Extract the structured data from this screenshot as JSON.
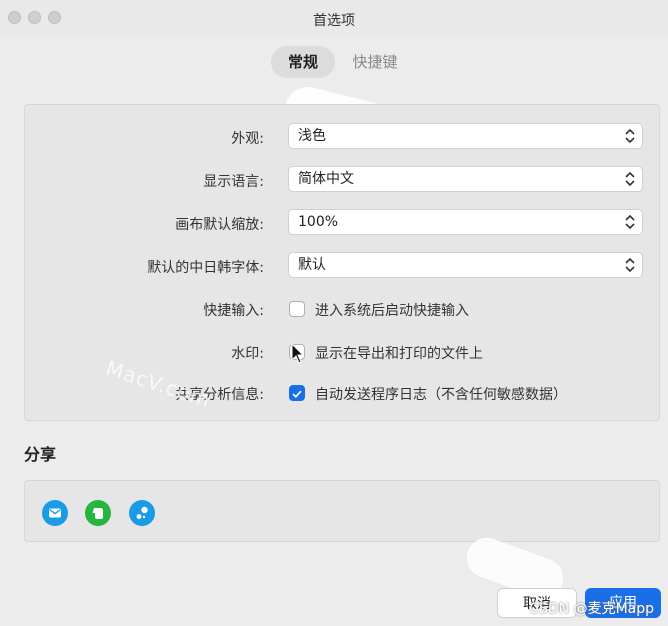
{
  "window": {
    "title": "首选项"
  },
  "tabs": [
    {
      "label": "常规",
      "active": true
    },
    {
      "label": "快捷键",
      "active": false
    }
  ],
  "general": {
    "appearance": {
      "label": "外观:",
      "value": "浅色"
    },
    "language": {
      "label": "显示语言:",
      "value": "简体中文"
    },
    "canvas_zoom": {
      "label": "画布默认缩放:",
      "value": "100%"
    },
    "cjk_font": {
      "label": "默认的中日韩字体:",
      "value": "默认"
    },
    "quick_input": {
      "label": "快捷输入:",
      "option": "进入系统后启动快捷输入",
      "checked": false
    },
    "watermark": {
      "label": "水印:",
      "option": "显示在导出和打印的文件上",
      "checked": false
    },
    "analytics": {
      "label": "共享分析信息:",
      "option": "自动发送程序日志（不含任何敏感数据）",
      "checked": true
    }
  },
  "share": {
    "title": "分享",
    "icons": [
      "mail-icon",
      "evernote-icon",
      "share-app-icon"
    ],
    "colors": {
      "mail": "#1a9be6",
      "evernote": "#27b53f",
      "app": "#1a9be6"
    }
  },
  "buttons": {
    "cancel": "取消",
    "apply": "应用"
  },
  "overlay": {
    "csdn": "CSDN @麦克Mapp",
    "macv": "MacV.com"
  },
  "colors": {
    "accent": "#1a6fe8",
    "background": "#ececec"
  }
}
